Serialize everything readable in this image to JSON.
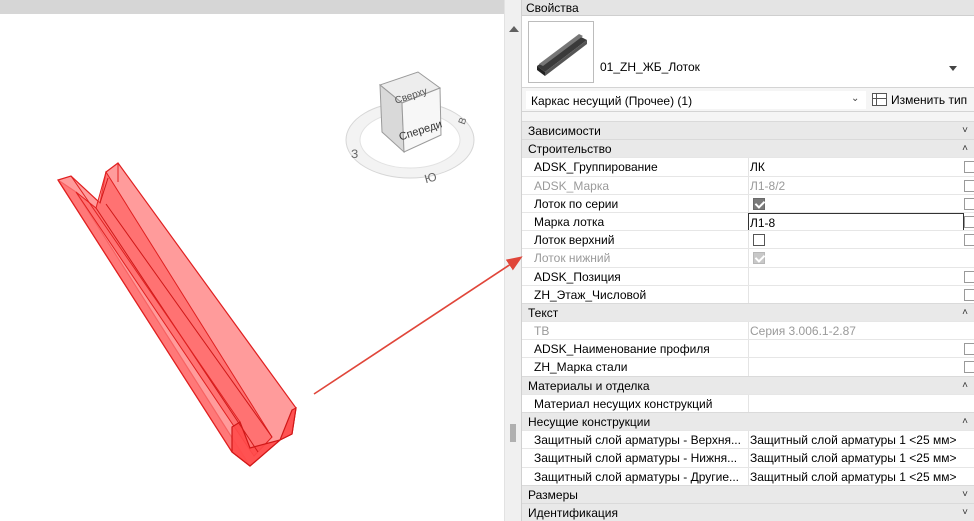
{
  "viewcube": {
    "face_top": "Сверху",
    "face_front": "Спереди",
    "compass_w": "З",
    "compass_s": "Ю",
    "compass_e": "В"
  },
  "properties": {
    "title": "Свойства",
    "type_name": "01_ZH_ЖБ_Лоток",
    "filter": "Каркас несущий (Прочее) (1)",
    "edit_type_label": "Изменить тип",
    "sections": [
      {
        "label": "Зависимости",
        "state": "collapsed",
        "rows": []
      },
      {
        "label": "Строительство",
        "state": "expanded",
        "rows": [
          {
            "name": "ADSK_Группирование",
            "value": "ЛК",
            "kind": "text",
            "disabled": false,
            "box": true
          },
          {
            "name": "ADSK_Марка",
            "value": "Л1-8/2",
            "kind": "text",
            "disabled": true,
            "box": true
          },
          {
            "name": "Лоток по серии",
            "value": "",
            "kind": "checkbox",
            "checked": true,
            "disabled": false,
            "box": true
          },
          {
            "name": "Марка лотка",
            "value": "Л1-8",
            "kind": "edit",
            "disabled": false,
            "box": true
          },
          {
            "name": "Лоток верхний",
            "value": "",
            "kind": "checkbox",
            "checked": false,
            "disabled": false,
            "box": true
          },
          {
            "name": "Лоток нижний",
            "value": "",
            "kind": "checkbox",
            "checked": true,
            "disabled": true,
            "box": false
          },
          {
            "name": "ADSK_Позиция",
            "value": "",
            "kind": "text",
            "disabled": false,
            "box": true
          },
          {
            "name": "ZH_Этаж_Числовой",
            "value": "",
            "kind": "text",
            "disabled": false,
            "box": true
          }
        ]
      },
      {
        "label": "Текст",
        "state": "expanded",
        "rows": [
          {
            "name": "ТВ",
            "value": "Серия 3.006.1-2.87",
            "kind": "text",
            "disabled": true,
            "box": false
          },
          {
            "name": "ADSK_Наименование профиля",
            "value": "",
            "kind": "text",
            "disabled": false,
            "box": true
          },
          {
            "name": "ZH_Марка стали",
            "value": "",
            "kind": "text",
            "disabled": false,
            "box": true
          }
        ]
      },
      {
        "label": "Материалы и отделка",
        "state": "expanded",
        "rows": [
          {
            "name": "Материал несущих конструкций",
            "value": "",
            "kind": "text",
            "disabled": false,
            "box": false
          }
        ]
      },
      {
        "label": "Несущие конструкции",
        "state": "expanded",
        "rows": [
          {
            "name": "Защитный слой арматуры - Верхня...",
            "value": "Защитный слой арматуры 1 <25 мм>",
            "kind": "text",
            "disabled": false,
            "box": false
          },
          {
            "name": "Защитный слой арматуры - Нижня...",
            "value": "Защитный слой арматуры 1 <25 мм>",
            "kind": "text",
            "disabled": false,
            "box": false
          },
          {
            "name": "Защитный слой арматуры - Другие...",
            "value": "Защитный слой арматуры 1 <25 мм>",
            "kind": "text",
            "disabled": false,
            "box": false
          }
        ]
      },
      {
        "label": "Размеры",
        "state": "collapsed",
        "rows": []
      },
      {
        "label": "Идентификация",
        "state": "collapsed",
        "rows": []
      }
    ]
  },
  "colors": {
    "model_fill": "#ff6b6b",
    "model_edge": "#e02020",
    "arrow": "#e0463a",
    "panel_bg": "#f5f5f5",
    "section_bg": "#e9e9e9"
  }
}
